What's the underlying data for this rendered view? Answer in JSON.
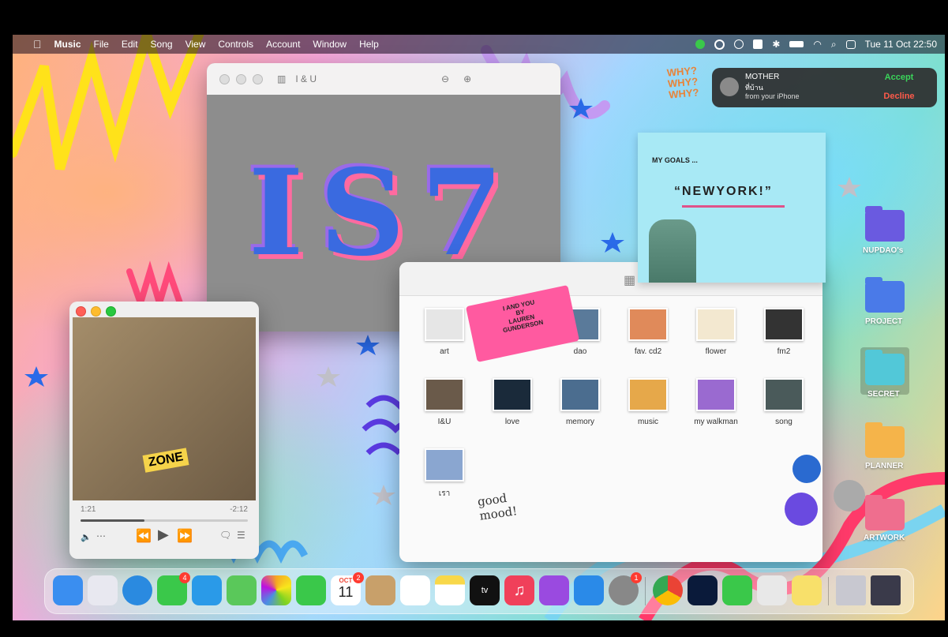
{
  "menubar": {
    "app_name": "Music",
    "menus": [
      "File",
      "Edit",
      "Song",
      "View",
      "Controls",
      "Account",
      "Window",
      "Help"
    ],
    "datetime": "Tue 11 Oct  22:50"
  },
  "notification": {
    "title": "MOTHER",
    "subtitle": "ที่บ้าน",
    "source": "from your iPhone",
    "accept": "Accept",
    "decline": "Decline"
  },
  "preview": {
    "title": "I & U",
    "art_text": "IS7"
  },
  "music_player": {
    "elapsed": "1:21",
    "remaining": "-2:12",
    "progress": 0.38
  },
  "goals_note": {
    "heading": "MY GOALS ...",
    "goal": "“NEWYORK!”"
  },
  "ticket": {
    "line1": "I AND YOU",
    "line2": "BY",
    "line3": "LAUREN",
    "line4": "GUNDERSON"
  },
  "finder": {
    "items": [
      {
        "label": "art",
        "color": "#e6e6e6"
      },
      {
        "label": "",
        "color": "#d7d7d7"
      },
      {
        "label": "dao",
        "color": "#5a7a9a"
      },
      {
        "label": "fav. cd2",
        "color": "#e08a5a"
      },
      {
        "label": "flower",
        "color": "#f3e8d0"
      },
      {
        "label": "fm2",
        "color": "#333333"
      },
      {
        "label": "I&U",
        "color": "#6a5a4a"
      },
      {
        "label": "love",
        "color": "#1a2a3a"
      },
      {
        "label": "memory",
        "color": "#4b6d8f"
      },
      {
        "label": "music",
        "color": "#e6a84a"
      },
      {
        "label": "my walkman",
        "color": "#9a6ad0"
      },
      {
        "label": "song",
        "color": "#4a5a5a"
      },
      {
        "label": "เรา",
        "color": "#8aa6d0"
      }
    ]
  },
  "desktop_folders": [
    {
      "label": "NUPDAO's",
      "color": "#6a5ae0"
    },
    {
      "label": "PROJECT",
      "color": "#4a7ae8"
    },
    {
      "label": "SECRET",
      "color": "#52c8d8"
    },
    {
      "label": "PLANNER",
      "color": "#f5b44a"
    },
    {
      "label": "ARTWORK",
      "color": "#ef6e8e"
    }
  ],
  "dock": {
    "calendar_month": "OCT",
    "calendar_day": "11",
    "apps": [
      {
        "name": "finder-icon",
        "color": "#3a8ef0"
      },
      {
        "name": "launchpad-icon",
        "color": "#e8e8f0"
      },
      {
        "name": "safari-icon",
        "color": "#2a8ae0"
      },
      {
        "name": "messages-icon",
        "color": "#3ac84a",
        "badge": "4"
      },
      {
        "name": "mail-icon",
        "color": "#2a9ae8"
      },
      {
        "name": "maps-icon",
        "color": "#5ac85a"
      },
      {
        "name": "photos-icon",
        "color": "#f0f0f0"
      },
      {
        "name": "facetime-icon",
        "color": "#3ac84a"
      },
      {
        "name": "calendar-icon",
        "color": "#ffffff",
        "badge": "2"
      },
      {
        "name": "contacts-icon",
        "color": "#c8a06a"
      },
      {
        "name": "reminders-icon",
        "color": "#ffffff"
      },
      {
        "name": "notes-icon",
        "color": "#f8d84a"
      },
      {
        "name": "apple-tv-icon",
        "color": "#111111"
      },
      {
        "name": "music-icon",
        "color": "#f0405a"
      },
      {
        "name": "podcasts-icon",
        "color": "#9a4ae0"
      },
      {
        "name": "app-store-icon",
        "color": "#2a8ae8"
      },
      {
        "name": "system-settings-icon",
        "color": "#888888",
        "badge": "1"
      },
      {
        "name": "chrome-icon",
        "color": "#ffffff"
      },
      {
        "name": "photoshop-icon",
        "color": "#0a1a3a"
      },
      {
        "name": "line-icon",
        "color": "#3ac84a"
      },
      {
        "name": "preview-app-icon",
        "color": "#e8e8e8"
      },
      {
        "name": "stickies-icon",
        "color": "#f8e06a"
      },
      {
        "name": "recent-window-1-icon",
        "color": "#c8c8d0"
      },
      {
        "name": "recent-window-2-icon",
        "color": "#3a3a4a"
      },
      {
        "name": "trash-icon",
        "color": "#dadada"
      }
    ]
  },
  "stickers": {
    "why": "WHY?",
    "good_mood": "good mood!",
    "nupdao_zone": "ZONE"
  }
}
